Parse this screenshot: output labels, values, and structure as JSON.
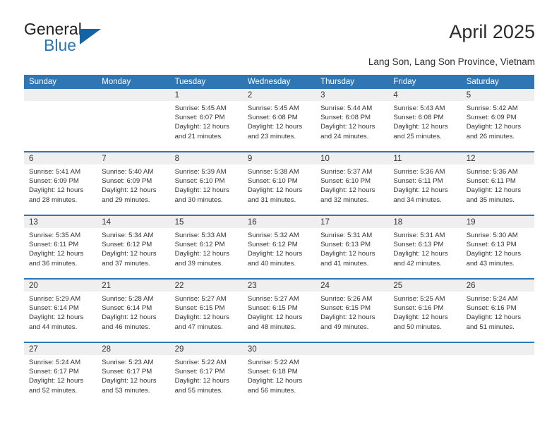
{
  "brand": {
    "name_part1": "General",
    "name_part2": "Blue",
    "triangle_color": "#1064a8",
    "blue_color": "#2677b8"
  },
  "header": {
    "title": "April 2025",
    "location": "Lang Son, Lang Son Province, Vietnam"
  },
  "theme": {
    "header_blue": "#2f76b4",
    "daynum_band": "#efefef",
    "text": "#333333"
  },
  "calendar": {
    "weekday_headers": [
      "Sunday",
      "Monday",
      "Tuesday",
      "Wednesday",
      "Thursday",
      "Friday",
      "Saturday"
    ],
    "weeks": [
      [
        {
          "day": ""
        },
        {
          "day": ""
        },
        {
          "day": "1",
          "sunrise": "Sunrise: 5:45 AM",
          "sunset": "Sunset: 6:07 PM",
          "daylight1": "Daylight: 12 hours",
          "daylight2": "and 21 minutes."
        },
        {
          "day": "2",
          "sunrise": "Sunrise: 5:45 AM",
          "sunset": "Sunset: 6:08 PM",
          "daylight1": "Daylight: 12 hours",
          "daylight2": "and 23 minutes."
        },
        {
          "day": "3",
          "sunrise": "Sunrise: 5:44 AM",
          "sunset": "Sunset: 6:08 PM",
          "daylight1": "Daylight: 12 hours",
          "daylight2": "and 24 minutes."
        },
        {
          "day": "4",
          "sunrise": "Sunrise: 5:43 AM",
          "sunset": "Sunset: 6:08 PM",
          "daylight1": "Daylight: 12 hours",
          "daylight2": "and 25 minutes."
        },
        {
          "day": "5",
          "sunrise": "Sunrise: 5:42 AM",
          "sunset": "Sunset: 6:09 PM",
          "daylight1": "Daylight: 12 hours",
          "daylight2": "and 26 minutes."
        }
      ],
      [
        {
          "day": "6",
          "sunrise": "Sunrise: 5:41 AM",
          "sunset": "Sunset: 6:09 PM",
          "daylight1": "Daylight: 12 hours",
          "daylight2": "and 28 minutes."
        },
        {
          "day": "7",
          "sunrise": "Sunrise: 5:40 AM",
          "sunset": "Sunset: 6:09 PM",
          "daylight1": "Daylight: 12 hours",
          "daylight2": "and 29 minutes."
        },
        {
          "day": "8",
          "sunrise": "Sunrise: 5:39 AM",
          "sunset": "Sunset: 6:10 PM",
          "daylight1": "Daylight: 12 hours",
          "daylight2": "and 30 minutes."
        },
        {
          "day": "9",
          "sunrise": "Sunrise: 5:38 AM",
          "sunset": "Sunset: 6:10 PM",
          "daylight1": "Daylight: 12 hours",
          "daylight2": "and 31 minutes."
        },
        {
          "day": "10",
          "sunrise": "Sunrise: 5:37 AM",
          "sunset": "Sunset: 6:10 PM",
          "daylight1": "Daylight: 12 hours",
          "daylight2": "and 32 minutes."
        },
        {
          "day": "11",
          "sunrise": "Sunrise: 5:36 AM",
          "sunset": "Sunset: 6:11 PM",
          "daylight1": "Daylight: 12 hours",
          "daylight2": "and 34 minutes."
        },
        {
          "day": "12",
          "sunrise": "Sunrise: 5:36 AM",
          "sunset": "Sunset: 6:11 PM",
          "daylight1": "Daylight: 12 hours",
          "daylight2": "and 35 minutes."
        }
      ],
      [
        {
          "day": "13",
          "sunrise": "Sunrise: 5:35 AM",
          "sunset": "Sunset: 6:11 PM",
          "daylight1": "Daylight: 12 hours",
          "daylight2": "and 36 minutes."
        },
        {
          "day": "14",
          "sunrise": "Sunrise: 5:34 AM",
          "sunset": "Sunset: 6:12 PM",
          "daylight1": "Daylight: 12 hours",
          "daylight2": "and 37 minutes."
        },
        {
          "day": "15",
          "sunrise": "Sunrise: 5:33 AM",
          "sunset": "Sunset: 6:12 PM",
          "daylight1": "Daylight: 12 hours",
          "daylight2": "and 39 minutes."
        },
        {
          "day": "16",
          "sunrise": "Sunrise: 5:32 AM",
          "sunset": "Sunset: 6:12 PM",
          "daylight1": "Daylight: 12 hours",
          "daylight2": "and 40 minutes."
        },
        {
          "day": "17",
          "sunrise": "Sunrise: 5:31 AM",
          "sunset": "Sunset: 6:13 PM",
          "daylight1": "Daylight: 12 hours",
          "daylight2": "and 41 minutes."
        },
        {
          "day": "18",
          "sunrise": "Sunrise: 5:31 AM",
          "sunset": "Sunset: 6:13 PM",
          "daylight1": "Daylight: 12 hours",
          "daylight2": "and 42 minutes."
        },
        {
          "day": "19",
          "sunrise": "Sunrise: 5:30 AM",
          "sunset": "Sunset: 6:13 PM",
          "daylight1": "Daylight: 12 hours",
          "daylight2": "and 43 minutes."
        }
      ],
      [
        {
          "day": "20",
          "sunrise": "Sunrise: 5:29 AM",
          "sunset": "Sunset: 6:14 PM",
          "daylight1": "Daylight: 12 hours",
          "daylight2": "and 44 minutes."
        },
        {
          "day": "21",
          "sunrise": "Sunrise: 5:28 AM",
          "sunset": "Sunset: 6:14 PM",
          "daylight1": "Daylight: 12 hours",
          "daylight2": "and 46 minutes."
        },
        {
          "day": "22",
          "sunrise": "Sunrise: 5:27 AM",
          "sunset": "Sunset: 6:15 PM",
          "daylight1": "Daylight: 12 hours",
          "daylight2": "and 47 minutes."
        },
        {
          "day": "23",
          "sunrise": "Sunrise: 5:27 AM",
          "sunset": "Sunset: 6:15 PM",
          "daylight1": "Daylight: 12 hours",
          "daylight2": "and 48 minutes."
        },
        {
          "day": "24",
          "sunrise": "Sunrise: 5:26 AM",
          "sunset": "Sunset: 6:15 PM",
          "daylight1": "Daylight: 12 hours",
          "daylight2": "and 49 minutes."
        },
        {
          "day": "25",
          "sunrise": "Sunrise: 5:25 AM",
          "sunset": "Sunset: 6:16 PM",
          "daylight1": "Daylight: 12 hours",
          "daylight2": "and 50 minutes."
        },
        {
          "day": "26",
          "sunrise": "Sunrise: 5:24 AM",
          "sunset": "Sunset: 6:16 PM",
          "daylight1": "Daylight: 12 hours",
          "daylight2": "and 51 minutes."
        }
      ],
      [
        {
          "day": "27",
          "sunrise": "Sunrise: 5:24 AM",
          "sunset": "Sunset: 6:17 PM",
          "daylight1": "Daylight: 12 hours",
          "daylight2": "and 52 minutes."
        },
        {
          "day": "28",
          "sunrise": "Sunrise: 5:23 AM",
          "sunset": "Sunset: 6:17 PM",
          "daylight1": "Daylight: 12 hours",
          "daylight2": "and 53 minutes."
        },
        {
          "day": "29",
          "sunrise": "Sunrise: 5:22 AM",
          "sunset": "Sunset: 6:17 PM",
          "daylight1": "Daylight: 12 hours",
          "daylight2": "and 55 minutes."
        },
        {
          "day": "30",
          "sunrise": "Sunrise: 5:22 AM",
          "sunset": "Sunset: 6:18 PM",
          "daylight1": "Daylight: 12 hours",
          "daylight2": "and 56 minutes."
        },
        {
          "day": ""
        },
        {
          "day": ""
        },
        {
          "day": ""
        }
      ]
    ]
  }
}
